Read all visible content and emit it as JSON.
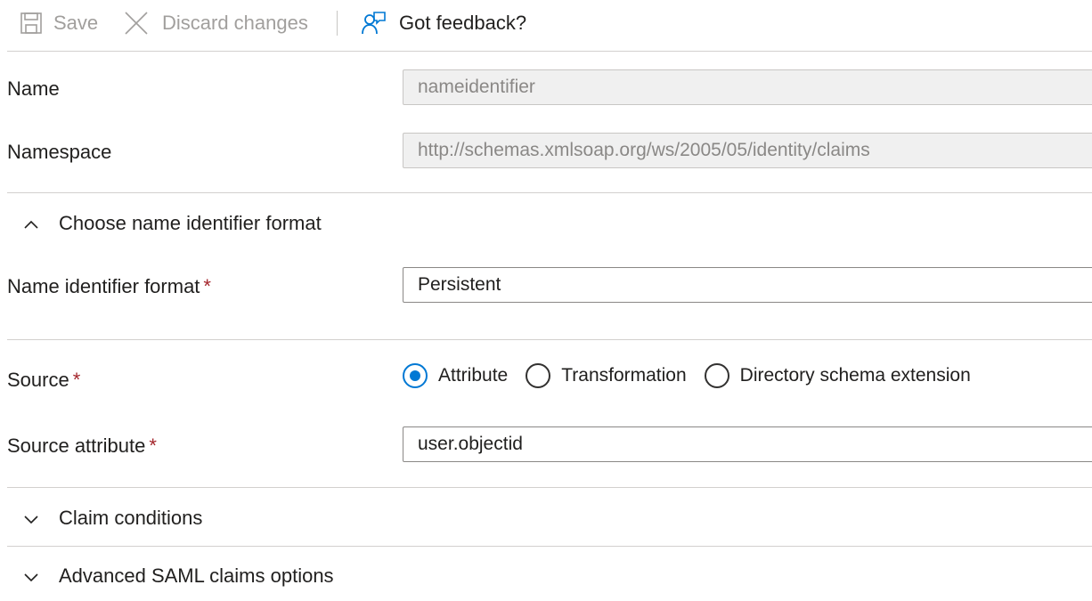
{
  "toolbar": {
    "save_label": "Save",
    "discard_label": "Discard changes",
    "feedback_label": "Got feedback?"
  },
  "form": {
    "name": {
      "label": "Name",
      "value": "nameidentifier"
    },
    "namespace": {
      "label": "Namespace",
      "value": "http://schemas.xmlsoap.org/ws/2005/05/identity/claims"
    },
    "format_section": {
      "title": "Choose name identifier format",
      "expanded": true
    },
    "name_identifier_format": {
      "label": "Name identifier format",
      "required_mark": "*",
      "value": "Persistent"
    },
    "source": {
      "label": "Source",
      "required_mark": "*",
      "options": [
        {
          "label": "Attribute",
          "checked": true
        },
        {
          "label": "Transformation",
          "checked": false
        },
        {
          "label": "Directory schema extension",
          "checked": false
        }
      ]
    },
    "source_attribute": {
      "label": "Source attribute",
      "required_mark": "*",
      "value": "user.objectid"
    },
    "claim_conditions": {
      "title": "Claim conditions",
      "expanded": false
    },
    "advanced_saml": {
      "title": "Advanced SAML claims options",
      "expanded": false
    }
  },
  "colors": {
    "accent": "#0078d4",
    "required": "#a4262c",
    "disabled_text": "#a19f9d",
    "disabled_field_bg": "#f0f0f0"
  },
  "icons": [
    "save-icon",
    "close-icon",
    "feedback-icon",
    "chevron-up-icon",
    "chevron-down-icon"
  ]
}
